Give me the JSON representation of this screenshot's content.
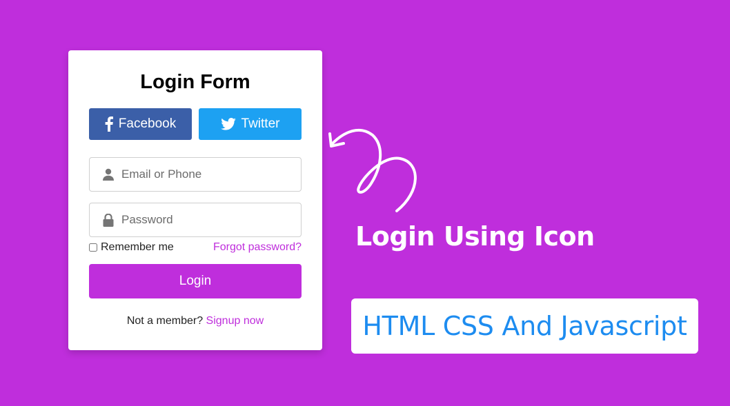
{
  "form": {
    "title": "Login Form",
    "facebook_label": "Facebook",
    "twitter_label": "Twitter",
    "email_placeholder": "Email or Phone",
    "password_placeholder": "Password",
    "remember_label": "Remember me",
    "remember_checked": false,
    "forgot_label": "Forgot password?",
    "login_label": "Login",
    "signup_prompt": "Not a member?",
    "signup_link": "Signup now"
  },
  "promo": {
    "headline": "Login Using Icon",
    "tagline": "HTML CSS And Javascript"
  },
  "colors": {
    "background": "#bf2edc",
    "facebook": "#3b5fa8",
    "twitter": "#1da1f2",
    "accent": "#bf2edc",
    "tagline_text": "#1d8cf0"
  },
  "icons": {
    "facebook": "facebook-icon",
    "twitter": "twitter-icon",
    "email_field": "user-icon",
    "password_field": "lock-icon",
    "decoration": "curly-arrow-icon"
  }
}
